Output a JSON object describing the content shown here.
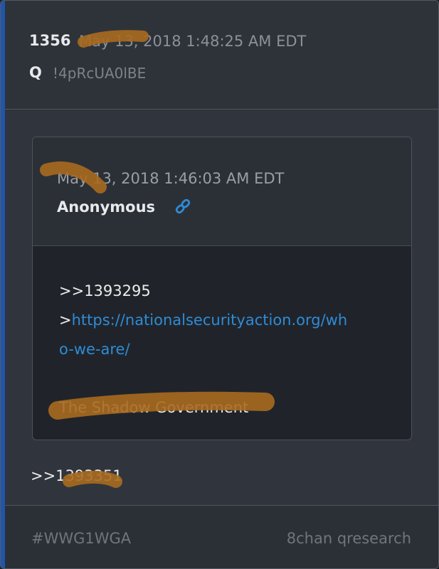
{
  "post": {
    "number": "1356",
    "timestamp": "May 13, 2018 1:48:25 AM EDT",
    "author": "Q",
    "tripcode": "!4pRcUA0lBE"
  },
  "quoted_post": {
    "timestamp": "May 13, 2018 1:46:03 AM EDT",
    "author": "Anonymous",
    "link_icon": "link-icon",
    "body": {
      "reference": ">>1393295",
      "link_prefix": ">",
      "link_line1": "https://nationalsecurityaction.org/wh",
      "link_line2": "o-we-are/",
      "message": "The Shadow Government"
    }
  },
  "reply_reference": ">>1393351",
  "footer": {
    "hashtag": "#WWG1WGA",
    "board": "8chan qresearch"
  },
  "colors": {
    "accent": "#1f56a8",
    "link": "#2f8bd6",
    "highlight_marker": "#a86a1f"
  }
}
